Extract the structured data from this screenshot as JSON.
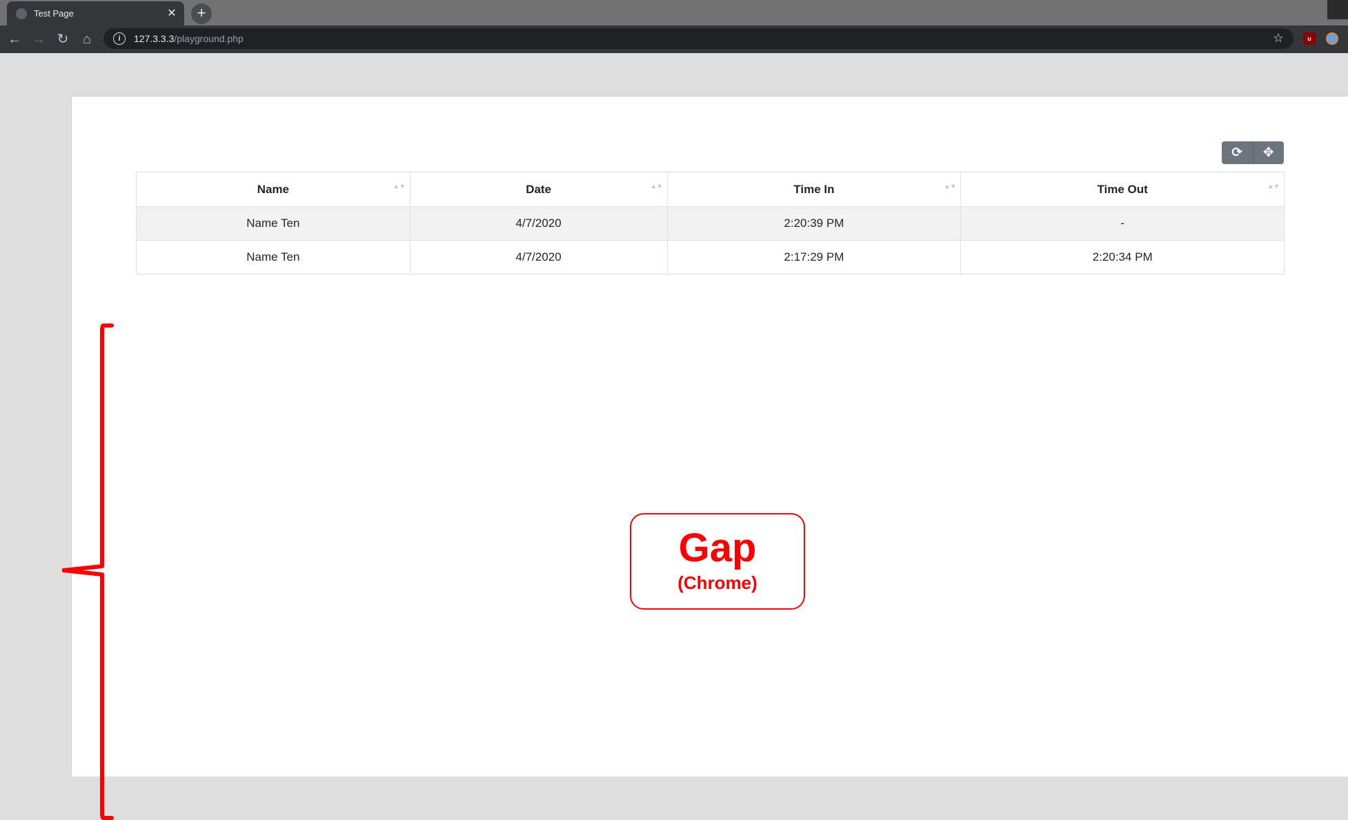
{
  "browser": {
    "tab_title": "Test Page",
    "tab_close": "✕",
    "new_tab": "+",
    "nav": {
      "back": "←",
      "forward": "→",
      "reload": "↻",
      "home": "⌂"
    },
    "url_host": "127.3.3.3",
    "url_path": "/playground.php",
    "info_icon": "i",
    "bookmark_star": "☆",
    "extension_1_label": "u"
  },
  "toolbar": {
    "refresh_icon": "⟳",
    "move_icon": "✥"
  },
  "table": {
    "columns": [
      "Name",
      "Date",
      "Time In",
      "Time Out"
    ],
    "sort_glyph": "▲▼",
    "rows": [
      [
        "Name Ten",
        "4/7/2020",
        "2:20:39 PM",
        "-"
      ],
      [
        "Name Ten",
        "4/7/2020",
        "2:17:29 PM",
        "2:20:34 PM"
      ]
    ]
  },
  "annotation": {
    "title": "Gap",
    "subtitle": "(Chrome)",
    "color": "#ff0000"
  }
}
